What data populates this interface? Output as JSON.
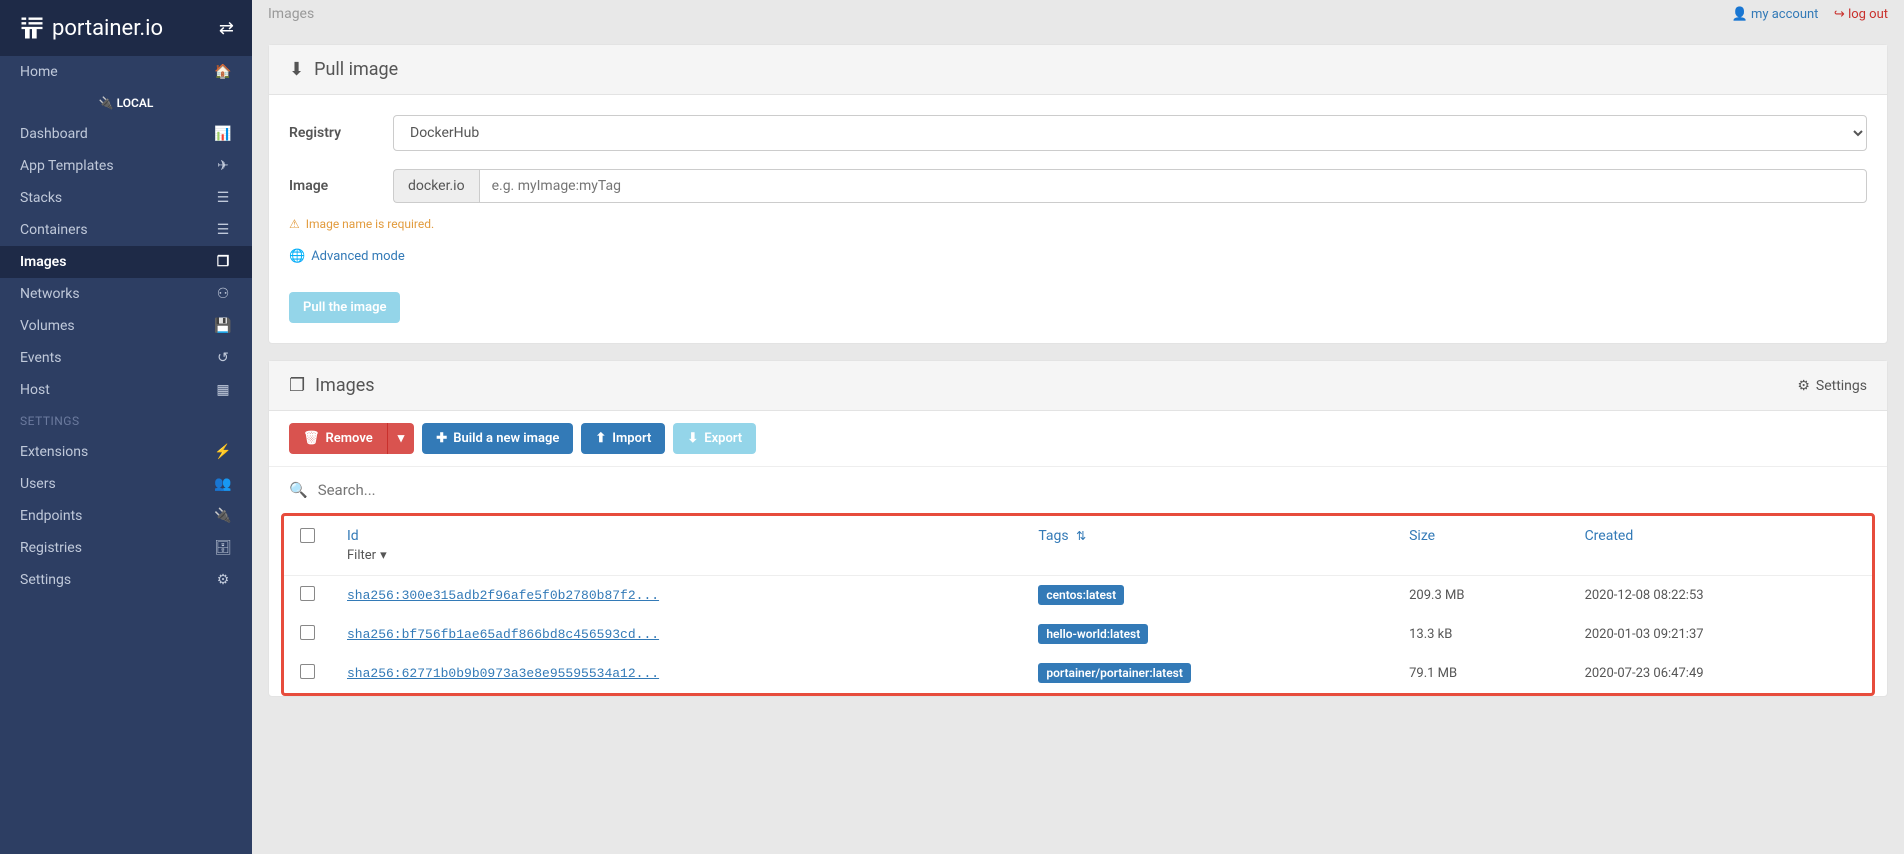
{
  "brand": "portainer.io",
  "sidebar": {
    "header": "LOCAL",
    "nav1": [
      {
        "label": "Home",
        "icon": "home"
      },
      {
        "label": "Dashboard",
        "icon": "dashboard"
      },
      {
        "label": "App Templates",
        "icon": "rocket"
      },
      {
        "label": "Stacks",
        "icon": "list"
      },
      {
        "label": "Containers",
        "icon": "list"
      },
      {
        "label": "Images",
        "icon": "copy",
        "active": true
      },
      {
        "label": "Networks",
        "icon": "sitemap"
      },
      {
        "label": "Volumes",
        "icon": "hdd"
      },
      {
        "label": "Events",
        "icon": "history"
      },
      {
        "label": "Host",
        "icon": "grid"
      }
    ],
    "section_title": "SETTINGS",
    "nav2": [
      {
        "label": "Extensions",
        "icon": "bolt"
      },
      {
        "label": "Users",
        "icon": "users"
      },
      {
        "label": "Endpoints",
        "icon": "plug"
      },
      {
        "label": "Registries",
        "icon": "database"
      },
      {
        "label": "Settings",
        "icon": "cogs"
      }
    ]
  },
  "header": {
    "breadcrumb": "Images",
    "my_account": "my account",
    "logout": "log out"
  },
  "pull_panel": {
    "title": "Pull image",
    "registry_label": "Registry",
    "registry_value": "DockerHub",
    "image_label": "Image",
    "image_prefix": "docker.io",
    "image_placeholder": "e.g. myImage:myTag",
    "warning": "Image name is required.",
    "advanced_link": "Advanced mode",
    "pull_button": "Pull the image"
  },
  "images_panel": {
    "title": "Images",
    "settings_label": "Settings",
    "remove_btn": "Remove",
    "build_btn": "Build a new image",
    "import_btn": "Import",
    "export_btn": "Export",
    "search_placeholder": "Search...",
    "columns": {
      "id": "Id",
      "filter": "Filter",
      "tags": "Tags",
      "size": "Size",
      "created": "Created"
    },
    "rows": [
      {
        "id": "sha256:300e315adb2f96afe5f0b2780b87f2...",
        "tag": "centos:latest",
        "size": "209.3 MB",
        "created": "2020-12-08 08:22:53"
      },
      {
        "id": "sha256:bf756fb1ae65adf866bd8c456593cd...",
        "tag": "hello-world:latest",
        "size": "13.3 kB",
        "created": "2020-01-03 09:21:37"
      },
      {
        "id": "sha256:62771b0b9b0973a3e8e95595534a12...",
        "tag": "portainer/portainer:latest",
        "size": "79.1 MB",
        "created": "2020-07-23 06:47:49"
      }
    ]
  }
}
